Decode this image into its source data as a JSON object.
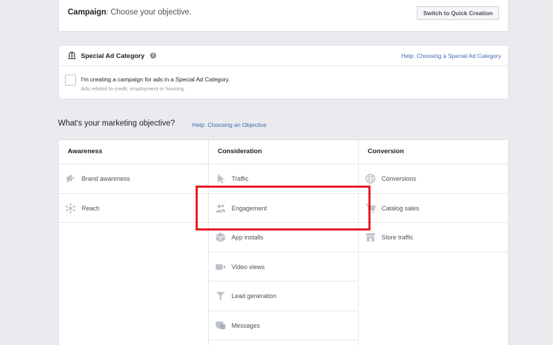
{
  "campaign": {
    "title_bold": "Campaign",
    "title_rest": ": Choose your objective.",
    "quick_creation_button": "Switch to Quick Creation"
  },
  "special_ad": {
    "title": "Special Ad Category",
    "info_icon": "info-icon",
    "help_link": "Help: Choosing a Special Ad Category",
    "checkbox_label": "I'm creating a campaign for ads in a Special Ad Category.",
    "checkbox_subtext": "Ads related to credit, employment or housing.",
    "checkbox_checked": false
  },
  "objective_question": {
    "text": "What's your marketing objective?",
    "help_link": "Help: Choosing an Objective"
  },
  "columns": [
    {
      "header": "Awareness",
      "items": [
        {
          "label": "Brand awareness",
          "icon": "megaphone-icon"
        },
        {
          "label": "Reach",
          "icon": "reach-icon"
        }
      ]
    },
    {
      "header": "Consideration",
      "items": [
        {
          "label": "Traffic",
          "icon": "cursor-icon"
        },
        {
          "label": "Engagement",
          "icon": "people-icon"
        },
        {
          "label": "App installs",
          "icon": "box-icon"
        },
        {
          "label": "Video views",
          "icon": "video-camera-icon"
        },
        {
          "label": "Lead generation",
          "icon": "filter-icon"
        },
        {
          "label": "Messages",
          "icon": "chat-icon"
        }
      ]
    },
    {
      "header": "Conversion",
      "items": [
        {
          "label": "Conversions",
          "icon": "globe-icon"
        },
        {
          "label": "Catalog sales",
          "icon": "shopping-cart-icon"
        },
        {
          "label": "Store traffic",
          "icon": "store-icon"
        }
      ]
    }
  ],
  "highlighted_item": "Engagement",
  "colors": {
    "background": "#e9ebee",
    "link": "#4267b2",
    "highlight": "#e8141c",
    "icon": "#bec3c9"
  }
}
